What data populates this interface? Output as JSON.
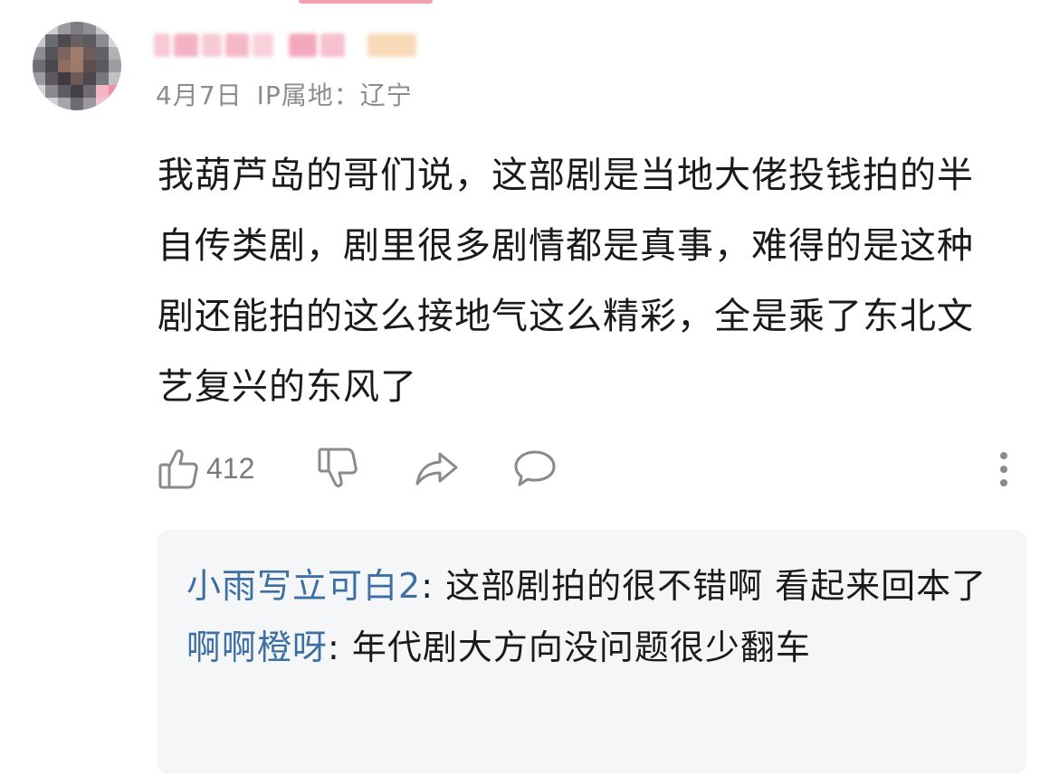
{
  "comment": {
    "date": "4月7日",
    "ip_location": "IP属地：辽宁",
    "text": "我葫芦岛的哥们说，这部剧是当地大佬投钱拍的半自传类剧，剧里很多剧情都是真事，难得的是这种剧还能拍的这么接地气这么精彩，全是乘了东北文艺复兴的东风了",
    "like_count": "412"
  },
  "icons": {
    "like": "thumbs-up-icon",
    "dislike": "thumbs-down-icon",
    "share": "share-arrow-icon",
    "reply": "speech-bubble-icon",
    "more": "more-vertical-icon"
  },
  "replies": [
    {
      "author": "小雨写立可白2",
      "separator": ": ",
      "text": "这部剧拍的很不错啊 看起来回本了"
    },
    {
      "author": "啊啊橙呀",
      "separator": ": ",
      "text": "年代剧大方向没问题很少翻车"
    }
  ],
  "colors": {
    "reply_author": "#3d6fa3",
    "meta_text": "#8c8c8c",
    "reply_background": "#f5f6f8",
    "icon_gray": "#8a8a8a"
  }
}
